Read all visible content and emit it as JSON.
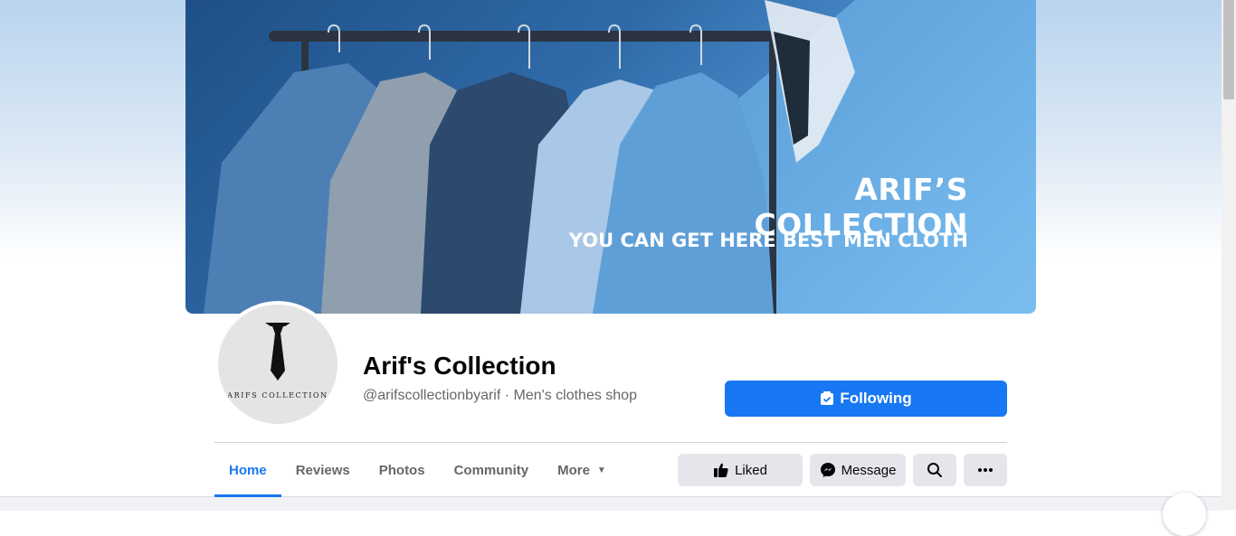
{
  "cover": {
    "title": "ARIF’S COLLECTION",
    "subtitle": "YOU CAN GET HERE BEST MEN CLOTH"
  },
  "avatar": {
    "text": "ARIFS COLLECTION"
  },
  "page": {
    "name": "Arif's Collection",
    "meta": "@arifscollectionbyarif · Men's clothes shop"
  },
  "buttons": {
    "following": "Following",
    "liked": "Liked",
    "message": "Message"
  },
  "tabs": [
    {
      "label": "Home",
      "active": true
    },
    {
      "label": "Reviews"
    },
    {
      "label": "Photos"
    },
    {
      "label": "Community"
    },
    {
      "label": "More"
    }
  ],
  "colors": {
    "accent": "#1877f2",
    "button_gray": "#e4e6eb"
  }
}
